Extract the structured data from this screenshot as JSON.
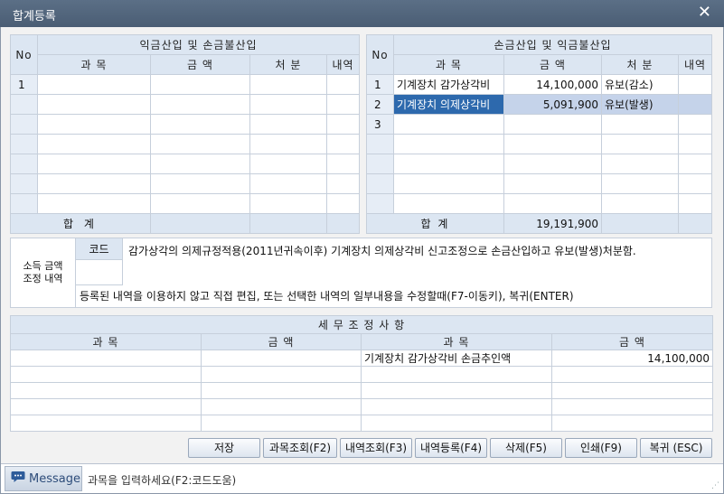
{
  "window": {
    "title": "합계등록",
    "close_glyph": "✕"
  },
  "left_table": {
    "no_header": "No",
    "group_header": "익금산입 및 손금불산입",
    "columns": [
      "과  목",
      "금    액",
      "처  분",
      "내역"
    ],
    "rows": [
      {
        "no": "1",
        "subject": "",
        "amount": "",
        "disposition": "",
        "detail": ""
      },
      {
        "no": "",
        "subject": "",
        "amount": "",
        "disposition": "",
        "detail": ""
      },
      {
        "no": "",
        "subject": "",
        "amount": "",
        "disposition": "",
        "detail": ""
      },
      {
        "no": "",
        "subject": "",
        "amount": "",
        "disposition": "",
        "detail": ""
      },
      {
        "no": "",
        "subject": "",
        "amount": "",
        "disposition": "",
        "detail": ""
      },
      {
        "no": "",
        "subject": "",
        "amount": "",
        "disposition": "",
        "detail": ""
      },
      {
        "no": "",
        "subject": "",
        "amount": "",
        "disposition": "",
        "detail": ""
      }
    ],
    "total_label": "합  계",
    "total_amount": ""
  },
  "right_table": {
    "no_header": "No",
    "group_header": "손금산입 및 익금불산입",
    "columns": [
      "과  목",
      "금  액",
      "처  분",
      "내역"
    ],
    "rows": [
      {
        "no": "1",
        "subject": "기계장치 감가상각비",
        "amount": "14,100,000",
        "disposition": "유보(감소)",
        "detail": ""
      },
      {
        "no": "2",
        "subject": "기계장치 의제상각비",
        "amount": "5,091,900",
        "disposition": "유보(발생)",
        "detail": ""
      },
      {
        "no": "3",
        "subject": "",
        "amount": "",
        "disposition": "",
        "detail": ""
      },
      {
        "no": "",
        "subject": "",
        "amount": "",
        "disposition": "",
        "detail": ""
      },
      {
        "no": "",
        "subject": "",
        "amount": "",
        "disposition": "",
        "detail": ""
      },
      {
        "no": "",
        "subject": "",
        "amount": "",
        "disposition": "",
        "detail": ""
      },
      {
        "no": "",
        "subject": "",
        "amount": "",
        "disposition": "",
        "detail": ""
      }
    ],
    "total_label": "합 계",
    "total_amount": "19,191,900"
  },
  "adjustment": {
    "label_line1": "소득 금액",
    "label_line2": "조정 내역",
    "code_header": "코드",
    "code_value": "",
    "description": "감가상각의 의제규정적용(2011년귀속이후) 기계장치 의제상각비 신고조정으로 손금산입하고 유보(발생)처분함.",
    "hint": "등록된 내역을 이용하지 않고 직접 편집, 또는 선택한 내역의 일부내용을 수정할때(F7-이동키), 복귀(ENTER)"
  },
  "tax_table": {
    "title": "세 무 조 정 사 항",
    "columns": [
      "과      목",
      "금      액",
      "과      목",
      "금      액"
    ],
    "rows": [
      {
        "subject1": "",
        "amount1": "",
        "subject2": "기계장치 감가상각비 손금추인액",
        "amount2": "14,100,000"
      },
      {
        "subject1": "",
        "amount1": "",
        "subject2": "",
        "amount2": ""
      },
      {
        "subject1": "",
        "amount1": "",
        "subject2": "",
        "amount2": ""
      },
      {
        "subject1": "",
        "amount1": "",
        "subject2": "",
        "amount2": ""
      },
      {
        "subject1": "",
        "amount1": "",
        "subject2": "",
        "amount2": ""
      }
    ]
  },
  "buttons": {
    "save": "저장",
    "subject_lookup": "과목조회(F2)",
    "detail_lookup": "내역조회(F3)",
    "detail_register": "내역등록(F4)",
    "delete": "삭제(F5)",
    "print": "인쇄(F9)",
    "back": "복귀 (ESC)"
  },
  "status": {
    "message_tag": "Message",
    "message_text": "과목을 입력하세요(F2:코드도움)",
    "icon": "chat-icon",
    "grip": "⋰"
  },
  "colors": {
    "titlebar": "#4f6279",
    "header": "#dce6f2",
    "selection": "#2d69ad"
  }
}
